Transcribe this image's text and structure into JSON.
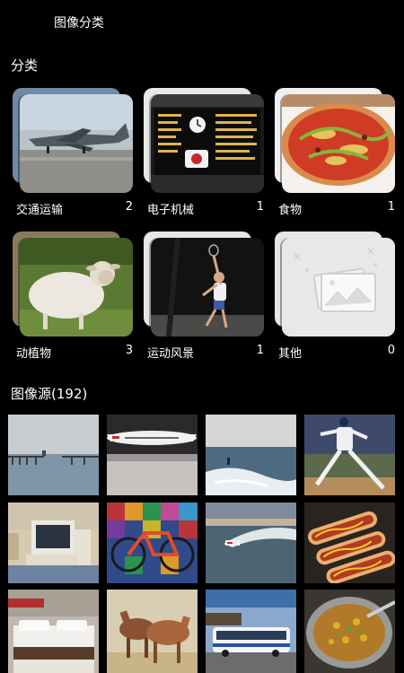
{
  "header": {
    "title": "图像分类"
  },
  "categories_section": {
    "label": "分类"
  },
  "categories": [
    {
      "name": "交通运输",
      "count": "2"
    },
    {
      "name": "电子机械",
      "count": "1"
    },
    {
      "name": "食物",
      "count": "1"
    },
    {
      "name": "动植物",
      "count": "3"
    },
    {
      "name": "运动风景",
      "count": "1"
    },
    {
      "name": "其他",
      "count": "0"
    }
  ],
  "sources_section": {
    "label": "图像源(192)"
  },
  "thumbnails": [
    "pier-photo",
    "airplane-photo",
    "surfer-photo",
    "pitcher-photo",
    "computer-photo",
    "bicycle-photo",
    "speedboat-photo",
    "hotdog-photo",
    "bedroom-photo",
    "horses-photo",
    "bus-photo",
    "soup-photo"
  ],
  "colors": {
    "background": "#000000",
    "text": "#ffffff",
    "placeholder": "#e6e6e6"
  }
}
